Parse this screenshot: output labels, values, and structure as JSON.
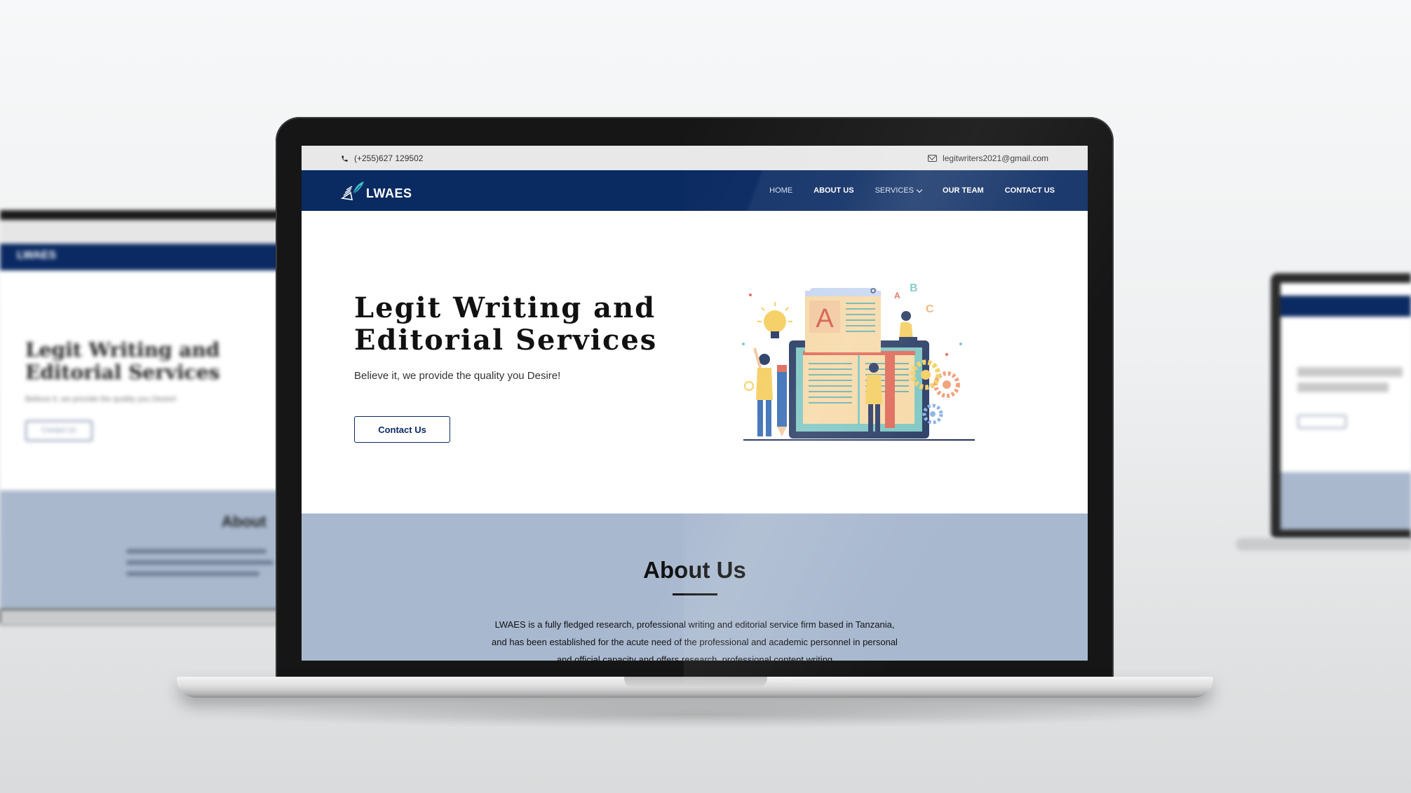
{
  "topbar": {
    "phone": "(+255)627 129502",
    "email": "legitwriters2021@gmail.com"
  },
  "brand": {
    "name": "LWAES",
    "primary_color": "#0a2a62"
  },
  "nav": {
    "items": [
      {
        "label": "HOME",
        "active": false
      },
      {
        "label": "ABOUT US",
        "active": true
      },
      {
        "label": "SERVICES",
        "has_dropdown": true
      },
      {
        "label": "OUR TEAM",
        "active": false
      },
      {
        "label": "CONTACT US",
        "active": false
      }
    ]
  },
  "hero": {
    "title": "Legit Writing and Editorial Services",
    "subtitle": "Believe it, we provide the quality you Desire!",
    "button_label": "Contact Us",
    "illustration_letter": "A",
    "floating_letters": [
      "A",
      "B",
      "C"
    ]
  },
  "about": {
    "title": "About Us",
    "text": "LWAES is a fully fledged research, professional writing and editorial service firm based in Tanzania, and has been established for the acute need of the professional and academic personnel in personal and official capacity and offers research, professional content writing",
    "background_color": "#a8b8cf"
  },
  "background_devices": {
    "left_title": "Legit Writing and Editorial Services",
    "left_about": "About"
  }
}
